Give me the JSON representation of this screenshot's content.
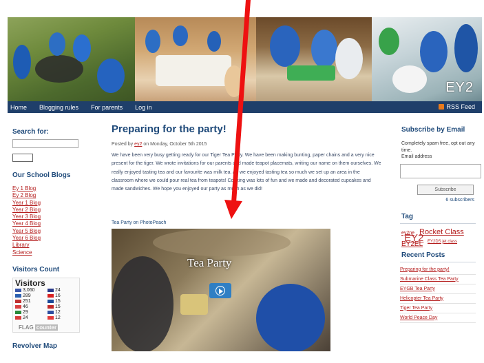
{
  "banner": {
    "badge": "EY2"
  },
  "nav": {
    "items": [
      "Home",
      "Blogging rules",
      "For parents",
      "Log in"
    ],
    "rss": "RSS Feed"
  },
  "left": {
    "search_title": "Search for:",
    "blogs_title": "Our School Blogs",
    "blogs": [
      "Ey 1 Blog",
      "Ey 2 Blog",
      "Year 1 Blog",
      "Year 2 Blog",
      "Year 3 Blog",
      "Year 4 Blog",
      "Year 5 Blog",
      "Year 6 Blog",
      "Library",
      "Science"
    ],
    "visitors_title": "Visitors Count",
    "visitors_widget_title": "Visitors",
    "visitors": [
      {
        "count": "3,060",
        "color": "#3b57a8"
      },
      {
        "count": "289",
        "color": "#2a5fb0"
      },
      {
        "count": "251",
        "color": "#c03030"
      },
      {
        "count": "46",
        "color": "#d84040"
      },
      {
        "count": "29",
        "color": "#2a8a3a"
      },
      {
        "count": "24",
        "color": "#d83a3a"
      },
      {
        "count": "24",
        "color": "#2a3a8a"
      },
      {
        "count": "16",
        "color": "#d82020"
      },
      {
        "count": "15",
        "color": "#1a4a9a"
      },
      {
        "count": "15",
        "color": "#c02828"
      },
      {
        "count": "12",
        "color": "#2e4ea0"
      },
      {
        "count": "12",
        "color": "#e33a3a"
      }
    ],
    "flag_label": "FLAG",
    "flag_counter": "counter",
    "revolver_title": "Revolver Map"
  },
  "post": {
    "title": "Preparing for the party!",
    "meta_prefix": "Posted by",
    "author": "ey2",
    "meta_suffix": "on Monday, October 5th 2015",
    "body": "We have been very busy getting ready for our Tiger Tea Party. We have been making bunting, paper chains and a very nice present for the tiger. We wrote invitations for our parents and made teapot placemats, writing our name on them ourselves. We really enjoyed tasting tea and our favourite was milk tea. As we enjoyed tasting tea so much we set up an area in the classroom where we could pour real tea from teapots! Cooking was lots of fun and we made and decorated cupcakes and made sandwiches. We hope you enjoyed our party as much as we did!",
    "peach_link": "Tea Party on PhotoPeach",
    "video_title": "Tea Party"
  },
  "right": {
    "subscribe_title": "Subscribe by Email",
    "subscribe_text": "Completely spam free, opt out any time.",
    "email_label": "Email address",
    "subscribe_button": "Subscribe",
    "subscriber_count": "6 subscribers",
    "tag_title": "Tag",
    "tags": [
      "ey2ne",
      "Rocket Class",
      "EY2",
      "EY2EL",
      "EY2DS jet class"
    ],
    "recent_title": "Recent Posts",
    "recent": [
      "Preparing for the party!",
      "Submarine Class Tea Party",
      "EYGB Tea Party",
      "Helicopter Tea Party",
      "Tiger Tea Party",
      "World Peace Day"
    ]
  },
  "colors": {
    "nav_bg": "#1f3f6a",
    "heading": "#1f4a7a",
    "link": "#b51e1e",
    "annotation_arrow": "#ee1111"
  }
}
